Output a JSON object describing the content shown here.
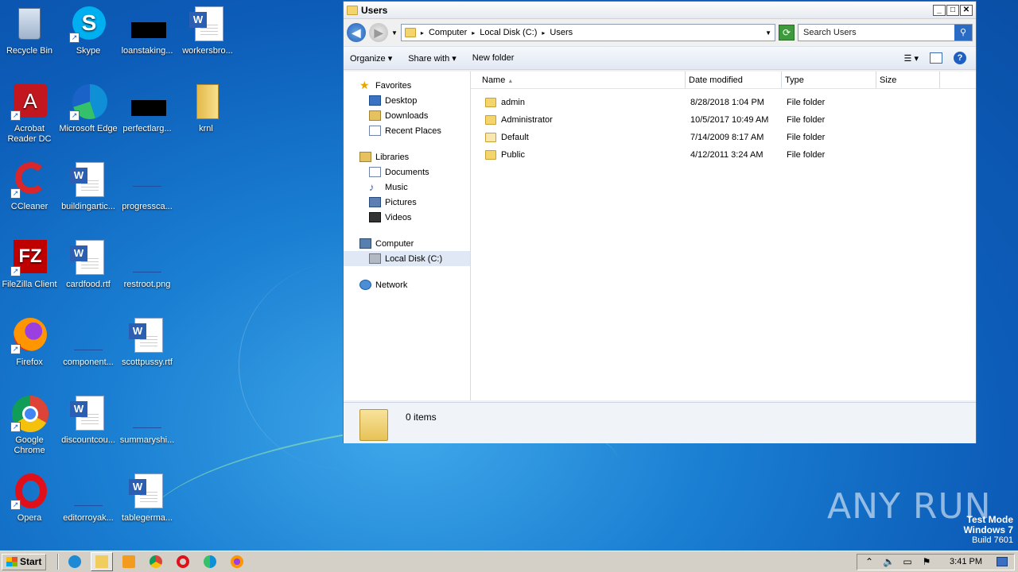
{
  "desktop": {
    "icons": [
      {
        "label": "Recycle Bin"
      },
      {
        "label": "Skype"
      },
      {
        "label": "loanstaking..."
      },
      {
        "label": "workersbro..."
      },
      {
        "label": "Acrobat Reader DC"
      },
      {
        "label": "Microsoft Edge"
      },
      {
        "label": "perfectlarg..."
      },
      {
        "label": "krnl"
      },
      {
        "label": "CCleaner"
      },
      {
        "label": "buildingartic..."
      },
      {
        "label": "progressca..."
      },
      {
        "label": "FileZilla Client"
      },
      {
        "label": "cardfood.rtf"
      },
      {
        "label": "restroot.png"
      },
      {
        "label": "Firefox"
      },
      {
        "label": "component..."
      },
      {
        "label": "scottpussy.rtf"
      },
      {
        "label": "Google Chrome"
      },
      {
        "label": "discountcou..."
      },
      {
        "label": "summaryshi..."
      },
      {
        "label": "Opera"
      },
      {
        "label": "editorroyak..."
      },
      {
        "label": "tablegerma..."
      }
    ]
  },
  "explorer": {
    "title": "Users",
    "address": {
      "crumbs": [
        "Computer",
        "Local Disk (C:)",
        "Users"
      ]
    },
    "search": {
      "placeholder": "Search Users"
    },
    "toolbar": {
      "organize": "Organize",
      "share_with": "Share with",
      "new_folder": "New folder"
    },
    "nav": {
      "favorites": "Favorites",
      "desktop": "Desktop",
      "downloads": "Downloads",
      "recent_places": "Recent Places",
      "libraries": "Libraries",
      "documents": "Documents",
      "music": "Music",
      "pictures": "Pictures",
      "videos": "Videos",
      "computer": "Computer",
      "local_disk": "Local Disk (C:)",
      "network": "Network"
    },
    "columns": {
      "name": "Name",
      "date": "Date modified",
      "type": "Type",
      "size": "Size"
    },
    "files": [
      {
        "name": "admin",
        "date": "8/28/2018 1:04 PM",
        "type": "File folder"
      },
      {
        "name": "Administrator",
        "date": "10/5/2017 10:49 AM",
        "type": "File folder"
      },
      {
        "name": "Default",
        "date": "7/14/2009 8:17 AM",
        "type": "File folder"
      },
      {
        "name": "Public",
        "date": "4/12/2011 3:24 AM",
        "type": "File folder"
      }
    ],
    "details": {
      "count": "0 items"
    }
  },
  "watermark": {
    "text": "ANY RUN"
  },
  "testmode": {
    "line1": "Test Mode",
    "line2": "Windows 7",
    "line3": "Build 7601"
  },
  "taskbar": {
    "start": "Start",
    "clock": "3:41 PM"
  }
}
